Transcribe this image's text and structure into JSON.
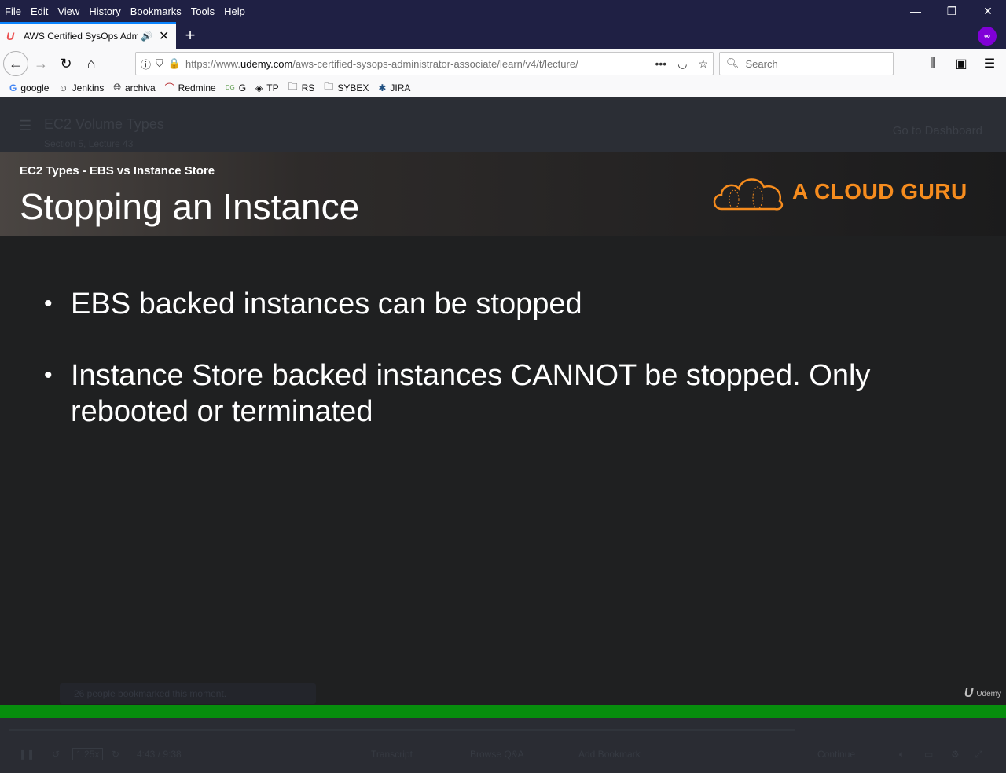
{
  "menu": [
    "File",
    "Edit",
    "View",
    "History",
    "Bookmarks",
    "Tools",
    "Help"
  ],
  "window_controls": {
    "minimize": "—",
    "restore": "❐",
    "close": "✕"
  },
  "tab": {
    "title": "AWS Certified SysOps Admi",
    "close": "✕",
    "new_tab": "+"
  },
  "navbar": {
    "url_prefix": "https://www.",
    "url_domain": "udemy.com",
    "url_path": "/aws-certified-sysops-administrator-associate/learn/v4/t/lecture/",
    "search_placeholder": "Search"
  },
  "bookmarks": [
    "google",
    "Jenkins",
    "archiva",
    "Redmine",
    "G",
    "TP",
    "RS",
    "SYBEX",
    "JIRA"
  ],
  "course_header": {
    "title": "EC2 Volume Types",
    "subtitle": "Section 5, Lecture 43",
    "dashboard_link": "Go to Dashboard"
  },
  "slide": {
    "kicker": "EC2 Types - EBS vs Instance Store",
    "title": "Stopping an Instance",
    "brand": "A CLOUD GURU",
    "bullets": [
      "EBS backed instances can be stopped",
      "Instance Store backed instances CANNOT be stopped. Only rebooted or terminated"
    ],
    "watermark": "Udemy"
  },
  "player": {
    "bookmark_note": "26 people bookmarked this moment.",
    "speed": "1.25x",
    "time": "4:43 / 9:38",
    "transcript": "Transcript",
    "browse_qa": "Browse Q&A",
    "add_bookmark": "Add Bookmark",
    "continue": "Continue"
  },
  "colors": {
    "chrome_dark": "#1f2044",
    "accent_tab": "#0a84ff",
    "brand_orange": "#f68c1e",
    "progress_green": "#078e0d",
    "private_purple": "#8000d7"
  }
}
